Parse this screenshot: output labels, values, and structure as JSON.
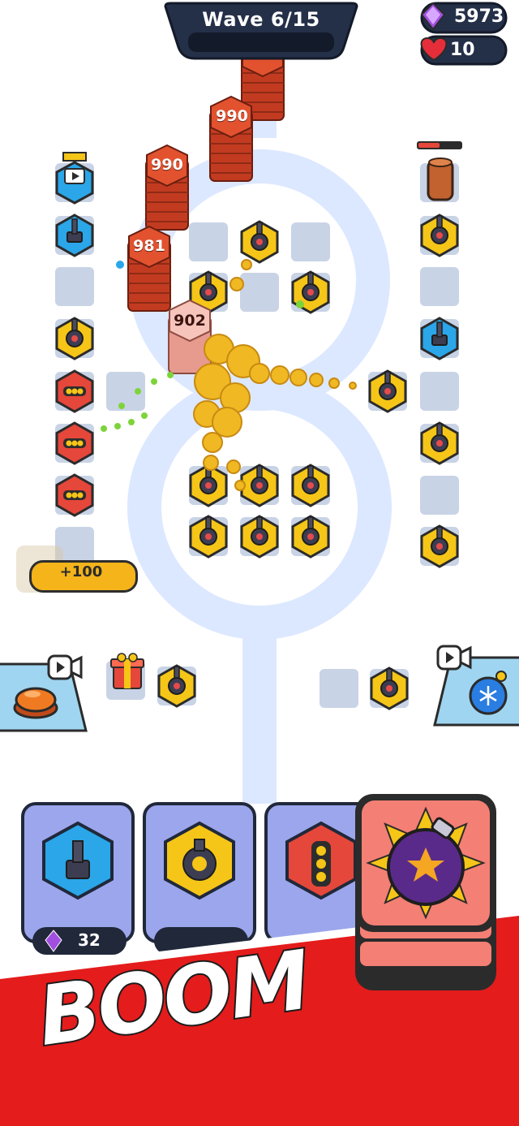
{
  "hud": {
    "wave_label": "Wave 6/15",
    "gems": "5973",
    "lives": "10",
    "gem_icon": "purple-gem-icon",
    "heart_icon": "heart-icon"
  },
  "enemies": [
    {
      "label": "990",
      "color": "#d9482b"
    },
    {
      "label": "990",
      "color": "#d9482b"
    },
    {
      "label": "981",
      "color": "#d9482b"
    },
    {
      "label": "902",
      "color": "#f2b4aa"
    }
  ],
  "bonus": {
    "label": "+100"
  },
  "shop": {
    "items": [
      {
        "name": "blue-hex-turret",
        "price": "32",
        "color": "#2aa6e9"
      },
      {
        "name": "yellow-hex-turret",
        "price": "",
        "color": "#f5c518"
      },
      {
        "name": "red-hex-turret",
        "price": "",
        "color": "#e5473a"
      }
    ],
    "featured": {
      "name": "bomb",
      "icon": "bomb-icon"
    }
  },
  "banner": {
    "text": "BOOM"
  },
  "colors": {
    "track": "#dce8ff",
    "slot": "#c9d3e6",
    "yellow": "#f5c518",
    "blue": "#2aa6e9",
    "red": "#e5473a",
    "enemy": "#d9482b"
  }
}
